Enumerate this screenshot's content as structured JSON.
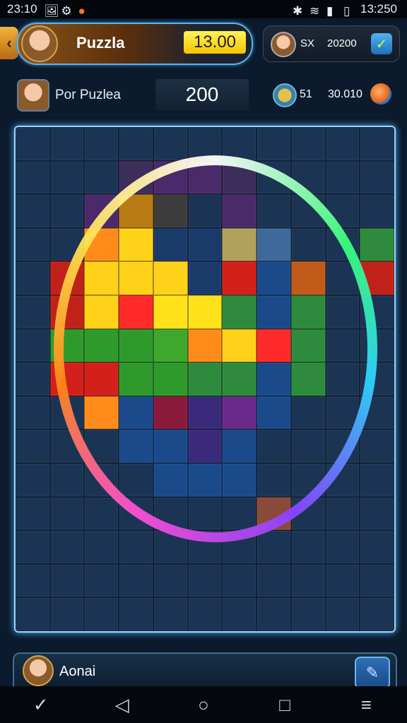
{
  "status_bar": {
    "left_time": "23:10",
    "right_time": "13:250"
  },
  "header": {
    "back_icon": "chevron-left-icon",
    "title": "Puzzla",
    "timer": "13.00",
    "opponent_label": "SX",
    "opponent_score": "20200",
    "confirm_icon": "check-icon"
  },
  "sub_bar": {
    "player_name": "Por Puzlea",
    "score": "200",
    "coins": "51",
    "points": "30.010"
  },
  "board": {
    "columns": 11,
    "rows": 15,
    "pieces": [
      [
        "#1b3454",
        "#1b3454",
        "#1b3454",
        "#1b3454",
        "#1b3454",
        "#1b3454",
        "#1b3454",
        "#1b3454",
        "#1b3454",
        "#1b3454",
        "#1b3454"
      ],
      [
        "#1b3454",
        "#1b3454",
        "#1b3454",
        "#3d2d5a",
        "#4a2a6a",
        "#4a2a6a",
        "#3d2d5a",
        "#1b3454",
        "#1b3454",
        "#1b3454",
        "#1b3454"
      ],
      [
        "#1b3454",
        "#1b3454",
        "#4a2a6a",
        "#b87a12",
        "#3c3c3c",
        "#1b3454",
        "#4a2a6a",
        "#1b3454",
        "#1b3454",
        "#1b3454",
        "#1b3454"
      ],
      [
        "#1b3454",
        "#1b3454",
        "#ff8c1a",
        "#ffd21a",
        "#1a3a6a",
        "#1a3a6a",
        "#b0a15c",
        "#3d6a9a",
        "#1b3454",
        "#1b3454",
        "#2e8a3c"
      ],
      [
        "#1b3454",
        "#c0221a",
        "#ffd21a",
        "#ffd21a",
        "#ffd21a",
        "#1a3a6a",
        "#d4201a",
        "#1a4a8a",
        "#c25a1a",
        "#1b3454",
        "#c0221a"
      ],
      [
        "#1b3454",
        "#c0221a",
        "#ffd21a",
        "#ff2a2a",
        "#ffe21a",
        "#ffe21a",
        "#2e8a3c",
        "#1a4a8a",
        "#2e8a3c",
        "#1b3454",
        "#1b3454"
      ],
      [
        "#1b3454",
        "#2e9a2c",
        "#2e9a2c",
        "#2e9a2c",
        "#3ea82c",
        "#ff8c1a",
        "#ffd21a",
        "#ff2a2a",
        "#2e8a3c",
        "#1b3454",
        "#1b3454"
      ],
      [
        "#1b3454",
        "#d4201a",
        "#d4201a",
        "#2e9a2c",
        "#2e9a2c",
        "#2e8a3c",
        "#2e8a3c",
        "#1a4a8a",
        "#2e8a3c",
        "#1b3454",
        "#1b3454"
      ],
      [
        "#1b3454",
        "#1b3454",
        "#ff8c1a",
        "#1a4a8a",
        "#8a1a3a",
        "#3a2a7a",
        "#6a2a8a",
        "#1a4a8a",
        "#1b3454",
        "#1b3454",
        "#1b3454"
      ],
      [
        "#1b3454",
        "#1b3454",
        "#1b3454",
        "#1a4a8a",
        "#1a4a8a",
        "#3a2a7a",
        "#1a4a8a",
        "#1b3454",
        "#1b3454",
        "#1b3454",
        "#1b3454"
      ],
      [
        "#1b3454",
        "#1b3454",
        "#1b3454",
        "#1b3454",
        "#1a4a8a",
        "#1a4a8a",
        "#1a4a8a",
        "#1b3454",
        "#1b3454",
        "#1b3454",
        "#1b3454"
      ],
      [
        "#1b3454",
        "#1b3454",
        "#1b3454",
        "#1b3454",
        "#1b3454",
        "#1b3454",
        "#1b3454",
        "#8a4a3a",
        "#1b3454",
        "#1b3454",
        "#1b3454"
      ],
      [
        "#1b3454",
        "#1b3454",
        "#1b3454",
        "#1b3454",
        "#1b3454",
        "#1b3454",
        "#1b3454",
        "#1b3454",
        "#1b3454",
        "#1b3454",
        "#1b3454"
      ],
      [
        "#1b3454",
        "#1b3454",
        "#1b3454",
        "#1b3454",
        "#1b3454",
        "#1b3454",
        "#1b3454",
        "#1b3454",
        "#1b3454",
        "#1b3454",
        "#1b3454"
      ],
      [
        "#1b3454",
        "#1b3454",
        "#1b3454",
        "#1b3454",
        "#1b3454",
        "#1b3454",
        "#1b3454",
        "#1b3454",
        "#1b3454",
        "#1b3454",
        "#1b3454"
      ]
    ]
  },
  "bottom_panel": {
    "name": "Aonai",
    "edit_icon": "edit-icon"
  },
  "nav_bar": {
    "back_icon": "triangle-back-icon",
    "home_icon": "circle-home-icon",
    "recents_icon": "square-recents-icon",
    "menu_icon": "menu-icon"
  }
}
